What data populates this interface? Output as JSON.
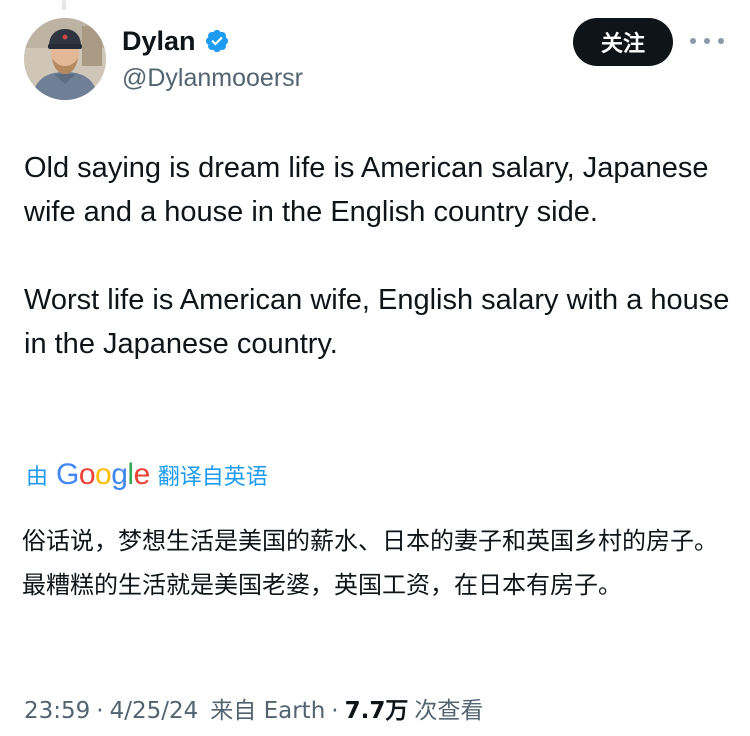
{
  "author": {
    "display_name": "Dylan",
    "handle": "@Dylanmooersr",
    "verified": true,
    "avatar_icon": "user-avatar-photo"
  },
  "actions": {
    "follow_label": "关注",
    "more_icon": "more-horizontal-icon"
  },
  "tweet": {
    "paragraphs": [
      "Old saying is dream life is American salary, Japanese wife and a house in the English country side.",
      "Worst life is American wife, English salary with a house in the Japanese country."
    ]
  },
  "translation": {
    "prefix": "由",
    "provider_letters": [
      "G",
      "o",
      "o",
      "g",
      "l",
      "e"
    ],
    "suffix": "翻译自英语",
    "paragraphs": [
      "俗话说，梦想生活是美国的薪水、日本的妻子和英国乡村的房子。",
      "最糟糕的生活就是美国老婆，英国工资，在日本有房子。"
    ]
  },
  "meta": {
    "time": "23:59",
    "date": "4/25/24",
    "source": "来自 Earth",
    "views": "7.7万",
    "views_suffix": "次查看"
  },
  "colors": {
    "text": "#0f1419",
    "secondary": "#536471",
    "link": "#1d9bf0",
    "verified": "#1d9bf0",
    "button_bg": "#0f1419"
  }
}
